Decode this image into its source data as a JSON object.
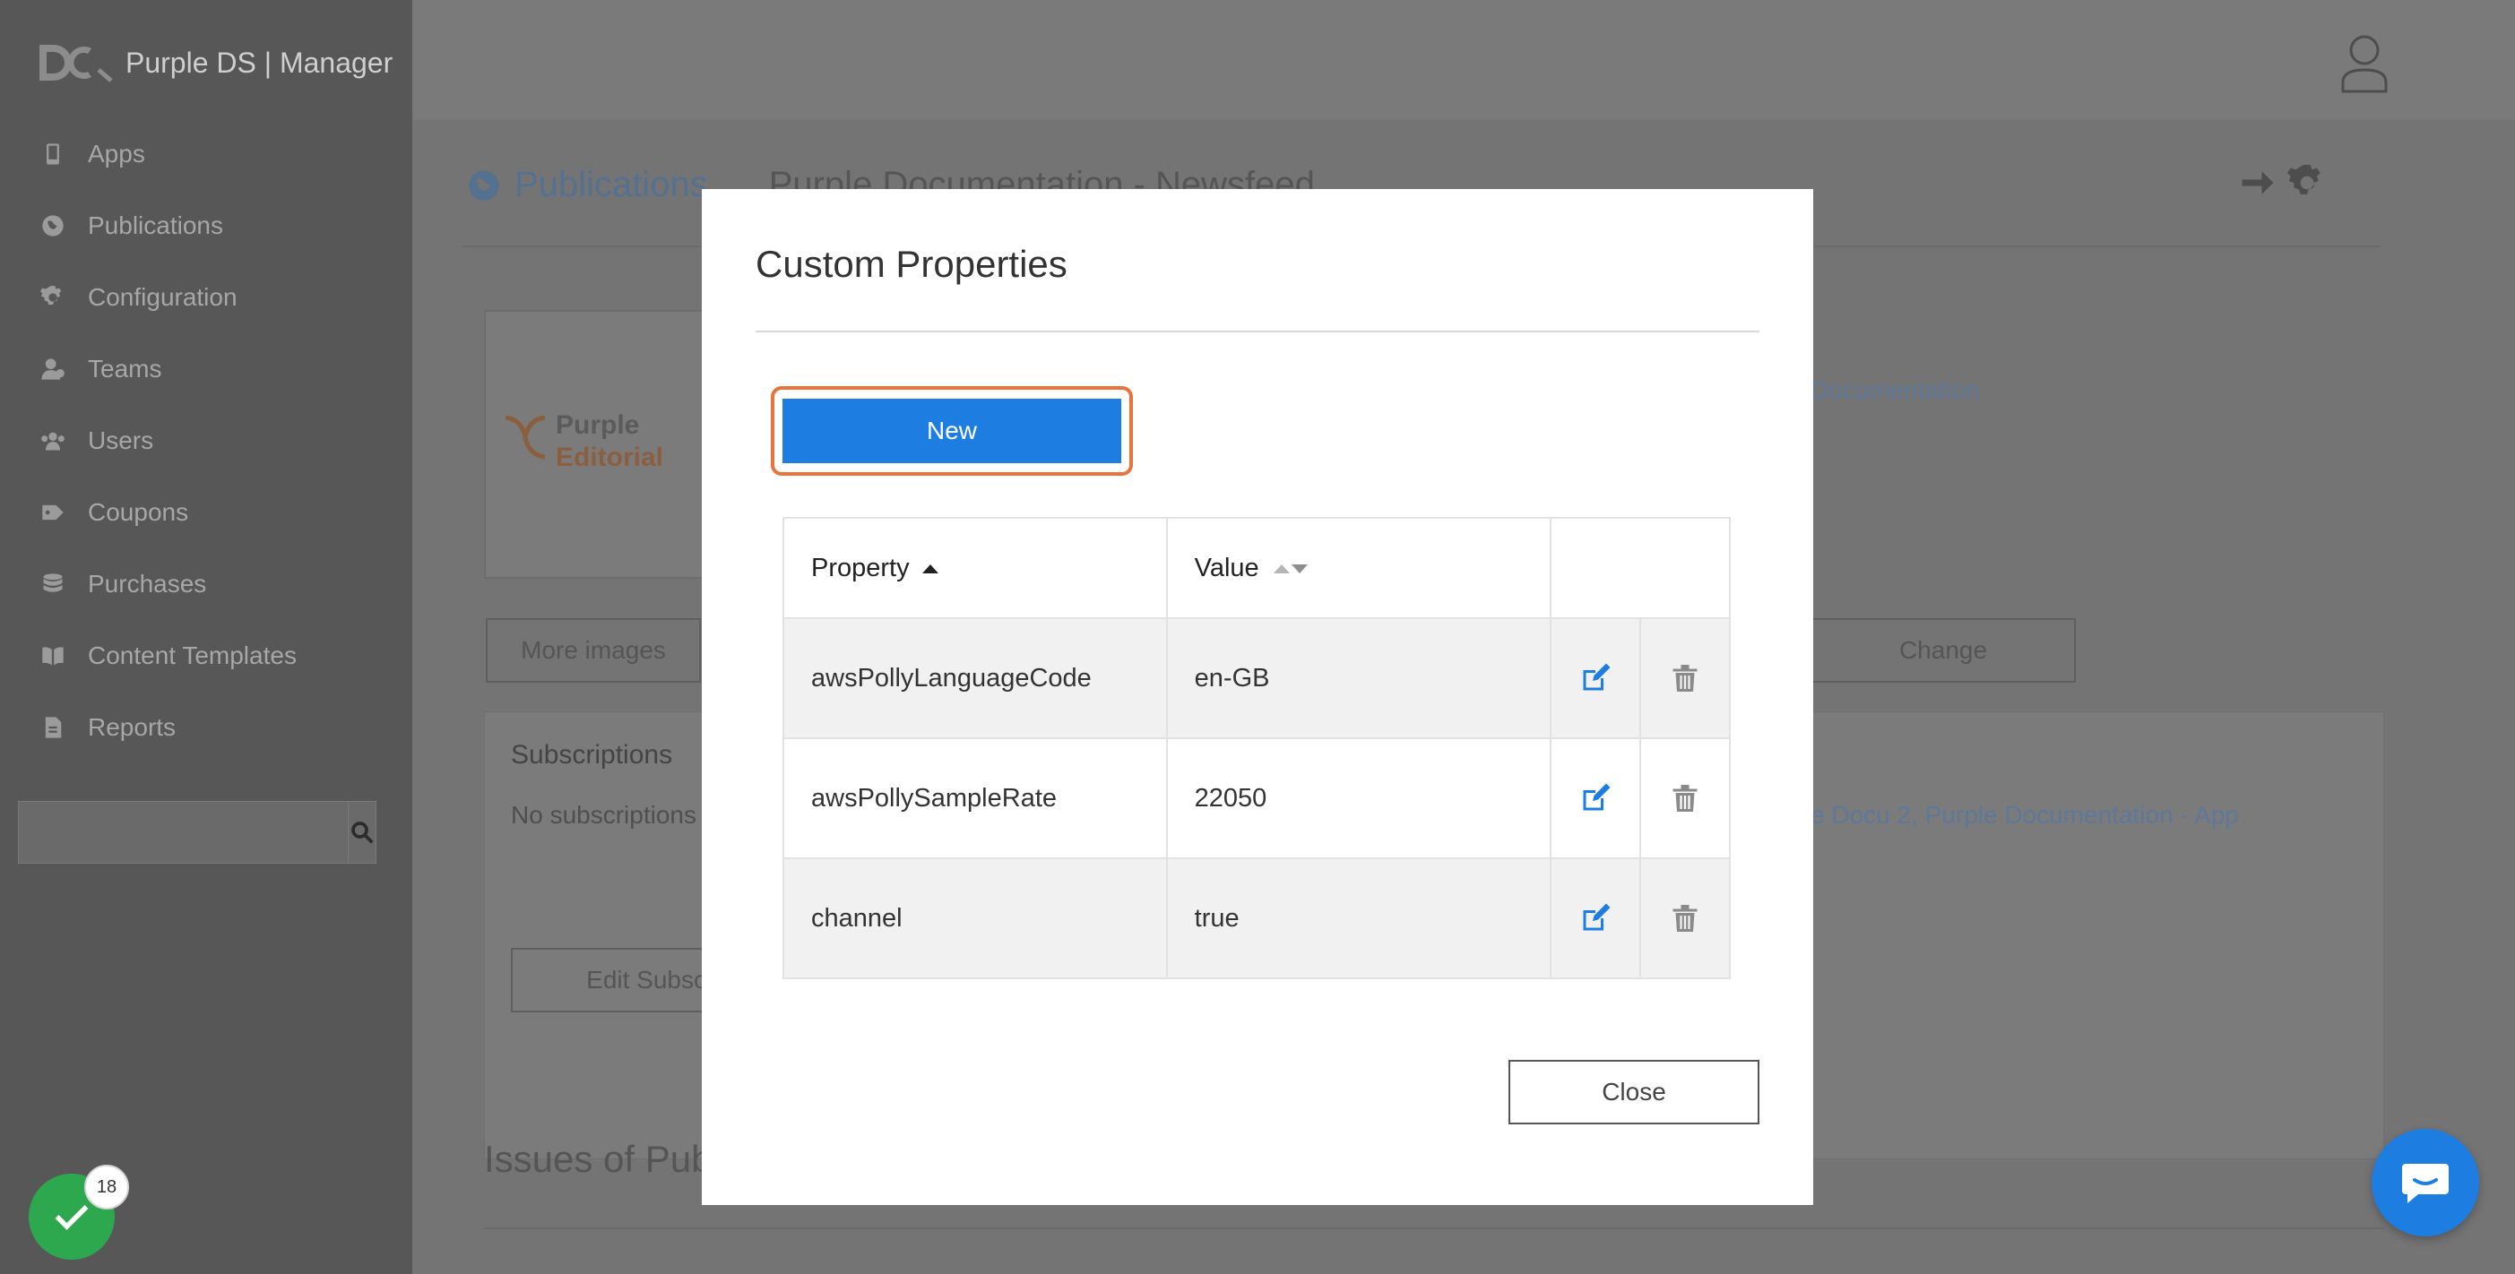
{
  "app": {
    "brand": "Purple DS | Manager"
  },
  "sidebar": {
    "items": [
      {
        "label": "Apps",
        "icon": "phone-icon"
      },
      {
        "label": "Publications",
        "icon": "globe-icon"
      },
      {
        "label": "Configuration",
        "icon": "gear-icon"
      },
      {
        "label": "Teams",
        "icon": "team-icon"
      },
      {
        "label": "Users",
        "icon": "users-icon"
      },
      {
        "label": "Coupons",
        "icon": "tag-icon"
      },
      {
        "label": "Purchases",
        "icon": "database-icon"
      },
      {
        "label": "Content Templates",
        "icon": "book-icon"
      },
      {
        "label": "Reports",
        "icon": "document-icon"
      }
    ],
    "search": {
      "placeholder": ""
    }
  },
  "page": {
    "breadcrumb": "Publications",
    "title": "Purple Documentation - Newsfeed",
    "logo_word1": "Purple",
    "logo_word2": "Editorial",
    "right_link": "Documentation",
    "more_images": "More images",
    "change": "Change",
    "subscriptions_title": "Subscriptions",
    "subscriptions_text": "No subscriptions",
    "subscriptions_links": "e Docu 2, Purple Documentation - App",
    "edit_subscriptions": "Edit Subsc",
    "issues_title": "Issues of Pub"
  },
  "modal": {
    "title": "Custom Properties",
    "new_label": "New",
    "close_label": "Close",
    "columns": {
      "property": "Property",
      "value": "Value"
    },
    "rows": [
      {
        "property": "awsPollyLanguageCode",
        "value": "en-GB"
      },
      {
        "property": "awsPollySampleRate",
        "value": "22050"
      },
      {
        "property": "channel",
        "value": "true"
      }
    ]
  },
  "widgets": {
    "badge_count": "18"
  },
  "colors": {
    "primary": "#1e7de0",
    "highlight_ring": "#e8743c",
    "success": "#2ea84f",
    "sidebar_bg": "#575757"
  }
}
